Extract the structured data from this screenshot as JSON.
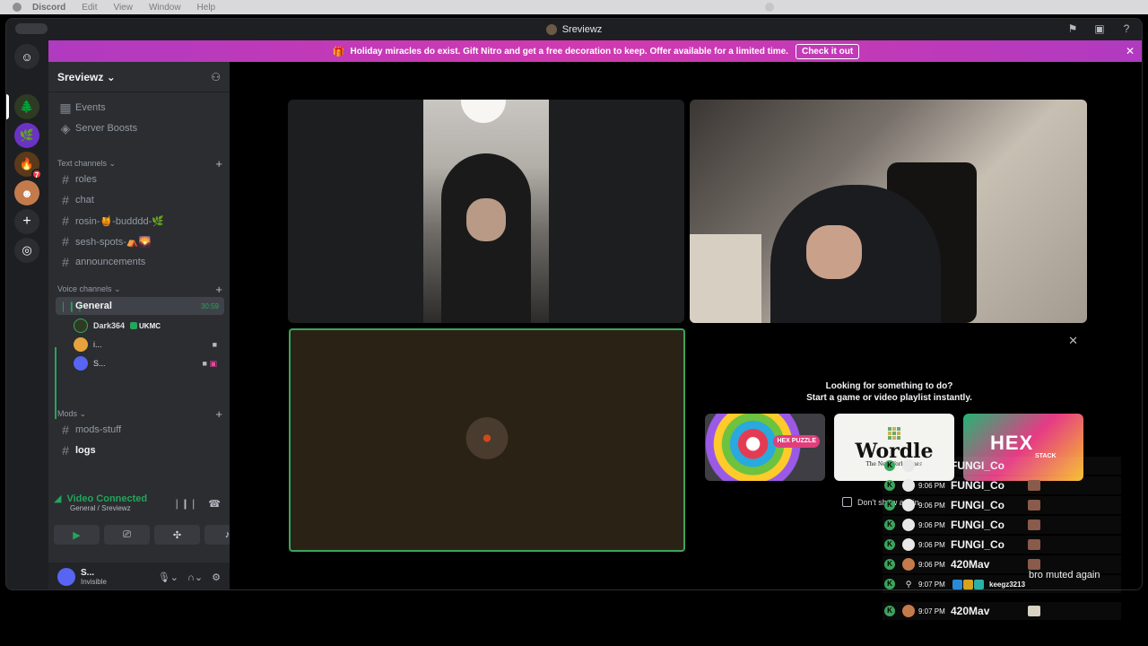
{
  "menubar": {
    "items": [
      "Discord",
      "Edit",
      "View",
      "Window",
      "Help"
    ]
  },
  "window": {
    "title": "Sreviewz"
  },
  "banner": {
    "text": "Holiday miracles do exist. Gift Nitro and get a free decoration to keep. Offer available for a limited time.",
    "button": "Check it out"
  },
  "rail": {
    "badge_count": "7"
  },
  "guild": {
    "name": "Sreviewz"
  },
  "sidebar": {
    "top_items": [
      {
        "label": "Events",
        "icon": "calendar-icon"
      },
      {
        "label": "Server Boosts",
        "icon": "boost-icon"
      }
    ],
    "text_category": "Text channels",
    "text_channels": [
      "roles",
      "chat",
      "rosin-🍯-budddd-🌿",
      "sesh-spots-⛺🌄",
      "announcements"
    ],
    "voice_category": "Voice channels",
    "voice_channel": {
      "name": "General",
      "timer": "30:59"
    },
    "voice_users": [
      {
        "name": "Dark364",
        "tag": "UKMC"
      },
      {
        "name": "i..."
      },
      {
        "name": "S..."
      }
    ],
    "mods_category": "Mods",
    "mods_channels": [
      "mods-stuff",
      "logs"
    ]
  },
  "voice_panel": {
    "status": "Video Connected",
    "location": "General / Sreviewz"
  },
  "user_panel": {
    "name": "S...",
    "status": "Invisible"
  },
  "activity": {
    "line1": "Looking for something to do?",
    "line2": "Start a game or video playlist instantly.",
    "cards": [
      {
        "name": "Hex Puzzle",
        "label": "HEX PUZZLE"
      },
      {
        "name": "Wordle",
        "title": "Wordle",
        "subtitle": "The New York Times"
      },
      {
        "name": "Hex Stack",
        "title": "HEX",
        "subtitle": "STACK"
      }
    ],
    "dont_show": "Don't show again"
  },
  "chat_overlay": [
    {
      "time": "9:06 PM",
      "name": "FUNGI_Co"
    },
    {
      "time": "9:06 PM",
      "name": "FUNGI_Co"
    },
    {
      "time": "9:06 PM",
      "name": "FUNGI_Co"
    },
    {
      "time": "9:06 PM",
      "name": "FUNGI_Co"
    },
    {
      "time": "9:06 PM",
      "name": "FUNGI_Co"
    },
    {
      "time": "9:06 PM",
      "name": "420Mav"
    },
    {
      "time": "9:07 PM",
      "name": "keegz3213",
      "message": "bro muted again"
    },
    {
      "time": "9:07 PM",
      "name": "420Mav"
    }
  ],
  "colors": {
    "accent_green": "#23a55a",
    "blurple": "#5865f2",
    "banner_pink": "#c63ab8",
    "sidebar_bg": "#2b2d31"
  }
}
